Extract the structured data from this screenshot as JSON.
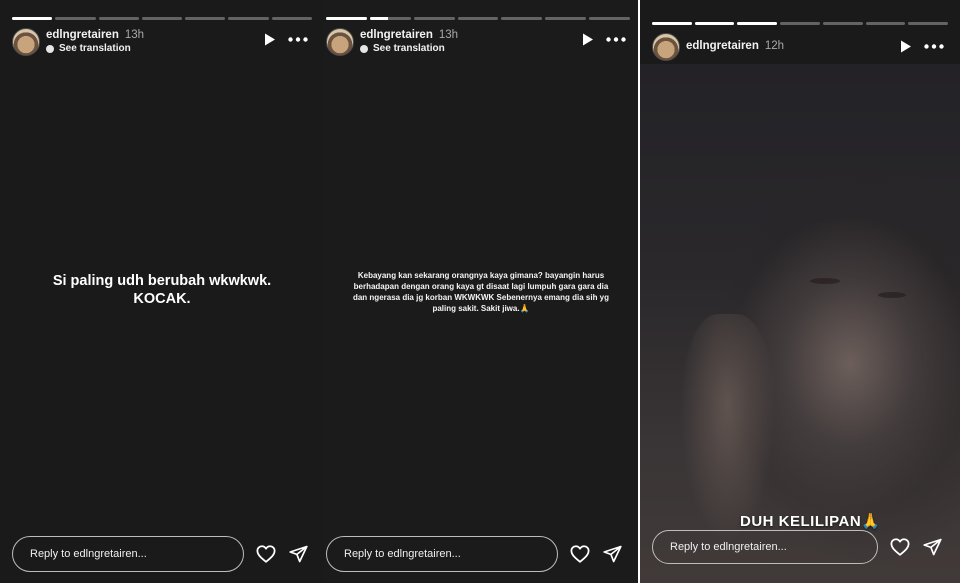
{
  "stories": [
    {
      "username": "edlngretairen",
      "time": "13h",
      "see_translation": "See translation",
      "progress": {
        "segments": 7,
        "viewed": 1,
        "current_fraction": 0
      },
      "text": "Si paling udh berubah wkwkwk.\nKOCAK.",
      "reply_placeholder": "Reply to edlngretairen..."
    },
    {
      "username": "edlngretairen",
      "time": "13h",
      "see_translation": "See translation",
      "progress": {
        "segments": 7,
        "viewed": 1,
        "current_fraction": 0.45
      },
      "text": "Kebayang kan sekarang orangnya kaya gimana? bayangin harus berhadapan dengan orang kaya gt disaat lagi lumpuh gara gara dia dan ngerasa dia jg korban WKWKWK Sebenernya emang dia sih yg paling sakit. Sakit jiwa.🙏",
      "reply_placeholder": "Reply to edlngretairen..."
    },
    {
      "username": "edlngretairen",
      "time": "12h",
      "progress": {
        "segments": 7,
        "viewed": 3,
        "current_fraction": 0
      },
      "caption": "DUH KELILIPAN🙏",
      "reply_placeholder": "Reply to edlngretairen..."
    }
  ],
  "colors": {
    "panel_bg": "#1a1a1a",
    "text": "#ffffff",
    "muted": "#a8a8a8",
    "progress_track": "rgba(255,255,255,0.32)"
  },
  "icons": {
    "play": "play-icon",
    "more": "more-horizontal-icon",
    "globe": "globe-icon",
    "like": "heart-icon",
    "share": "send-icon"
  }
}
